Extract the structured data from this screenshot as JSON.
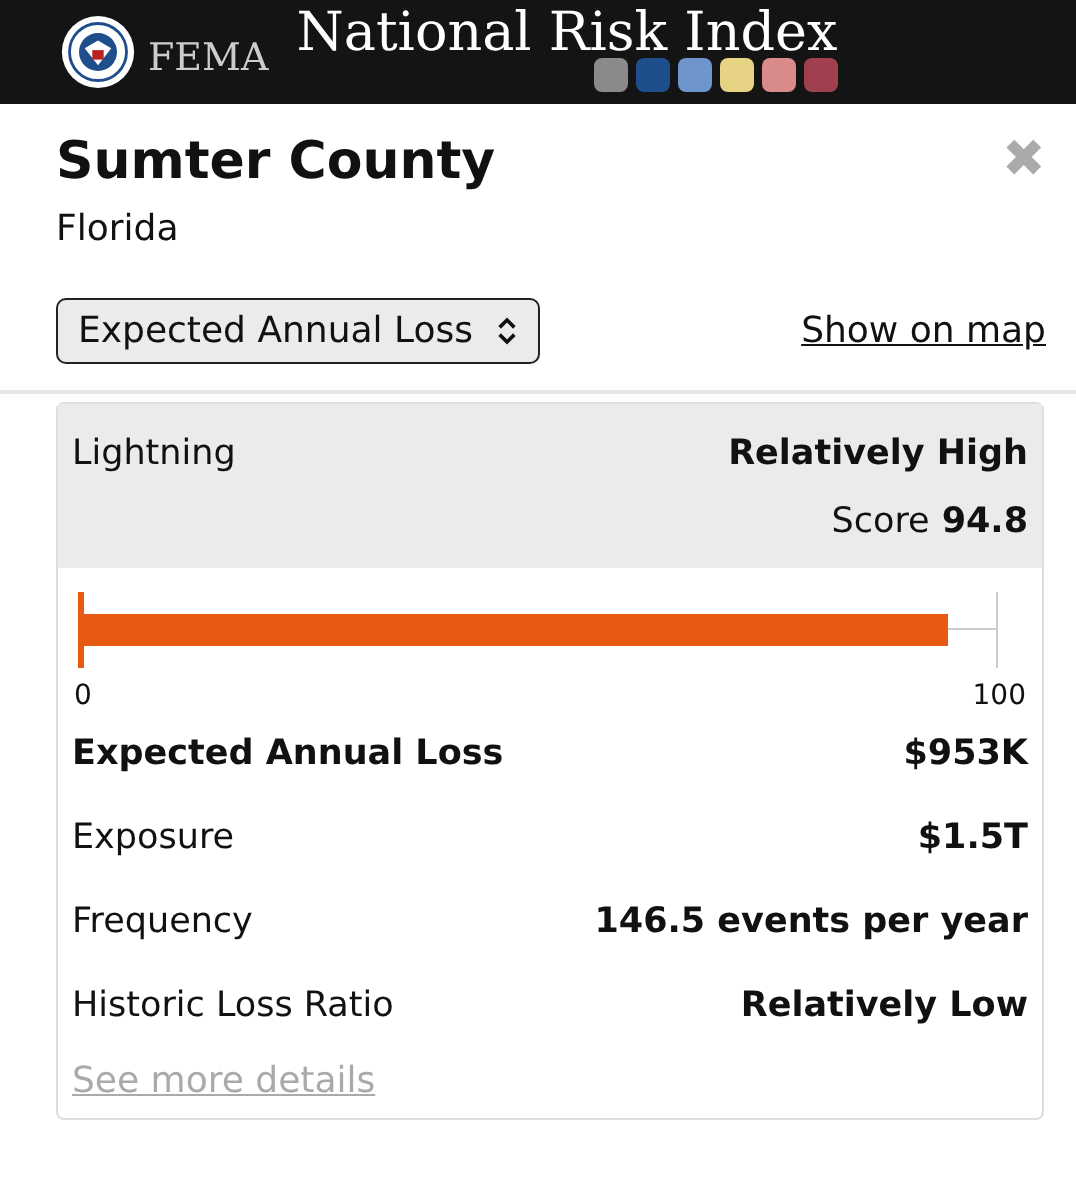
{
  "header": {
    "agency": "FEMA",
    "title": "National Risk Index",
    "swatches": [
      {
        "color": "#8a8a8a"
      },
      {
        "color": "#1f4e8c"
      },
      {
        "color": "#6f96cc"
      },
      {
        "color": "#e6d383"
      },
      {
        "color": "#d98a8a"
      },
      {
        "color": "#a0404f"
      }
    ]
  },
  "panel": {
    "title": "Sumter County",
    "subtitle": "Florida",
    "close": "✖",
    "dropdown": {
      "value": "Expected Annual Loss"
    },
    "map_link": "Show on map"
  },
  "card": {
    "hazard": "Lightning",
    "rating": "Relatively High",
    "score_label": "Score",
    "score": "94.8",
    "bar": {
      "level": 0.948,
      "min": "0",
      "max": "100"
    },
    "rows": [
      {
        "kind": "total",
        "label": "Expected Annual Loss",
        "value": "$953K"
      },
      {
        "kind": "metric",
        "label": "Exposure",
        "value": "$1.5T"
      },
      {
        "kind": "metric",
        "label": "Frequency",
        "value": "146.5 events per year"
      },
      {
        "kind": "metric",
        "label": "Historic Loss Ratio",
        "value": "Relatively Low"
      }
    ],
    "more_link": "See more details"
  }
}
